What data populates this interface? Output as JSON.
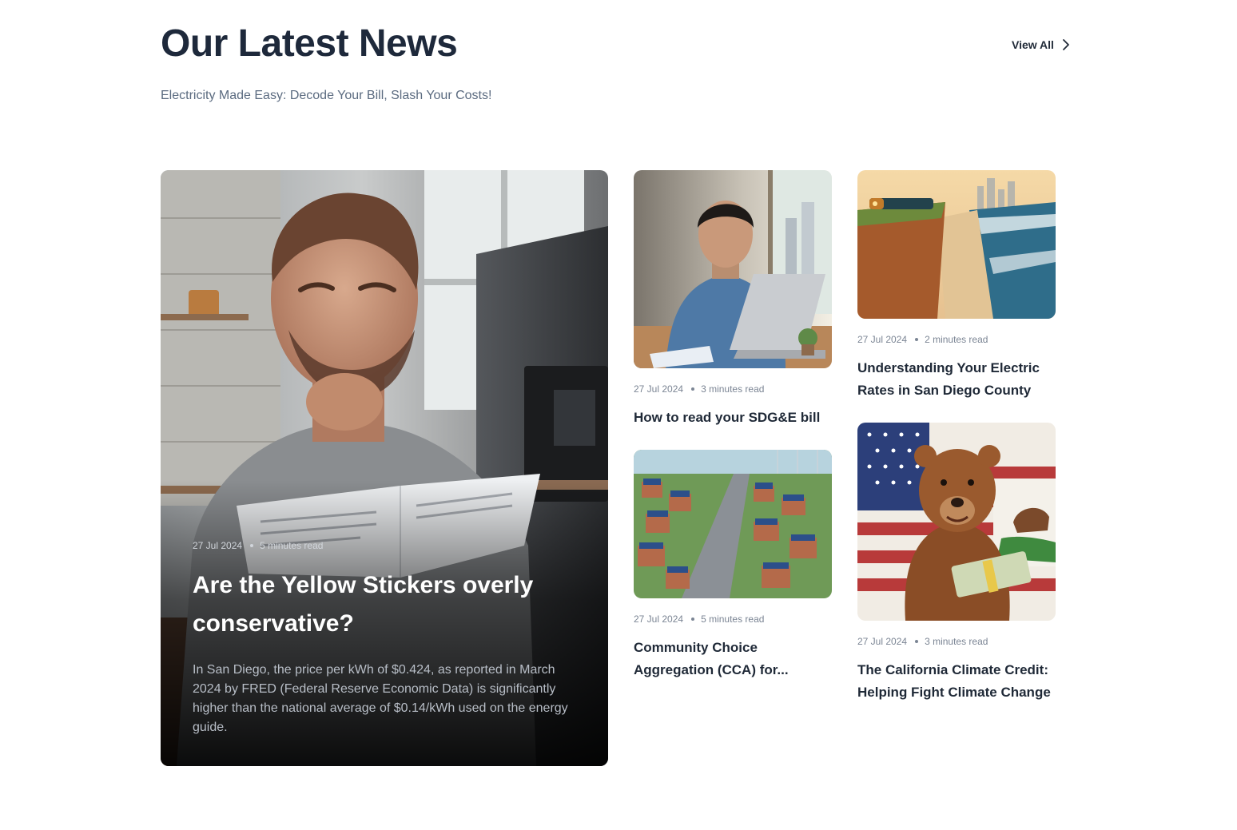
{
  "header": {
    "title": "Our Latest News",
    "subtitle": "Electricity Made Easy: Decode Your Bill, Slash Your Costs!",
    "view_all_label": "View All"
  },
  "featured": {
    "date": "27 Jul 2024",
    "read_time": "5 minutes read",
    "title": "Are the Yellow Stickers overly conservative?",
    "excerpt": "In San Diego, the price per kWh of $0.424, as reported in March 2024 by FRED (Federal Reserve Economic Data) is significantly higher than the national average of $0.14/kWh used on the energy guide.",
    "image": "man-reading-energy-guide-image"
  },
  "articles": [
    {
      "date": "27 Jul 2024",
      "read_time": "3 minutes read",
      "title": "How to read your SDG&E bill",
      "image": "man-at-laptop-image"
    },
    {
      "date": "27 Jul 2024",
      "read_time": "5 minutes read",
      "title": "Community Choice Aggregation (CCA) for...",
      "image": "solar-neighborhood-image"
    },
    {
      "date": "27 Jul 2024",
      "read_time": "2 minutes read",
      "title": "Understanding Your Electric Rates in San Diego County",
      "image": "coastal-train-image"
    },
    {
      "date": "27 Jul 2024",
      "read_time": "3 minutes read",
      "title": "The California Climate Credit: Helping Fight Climate Change",
      "image": "bear-with-money-image"
    }
  ]
}
